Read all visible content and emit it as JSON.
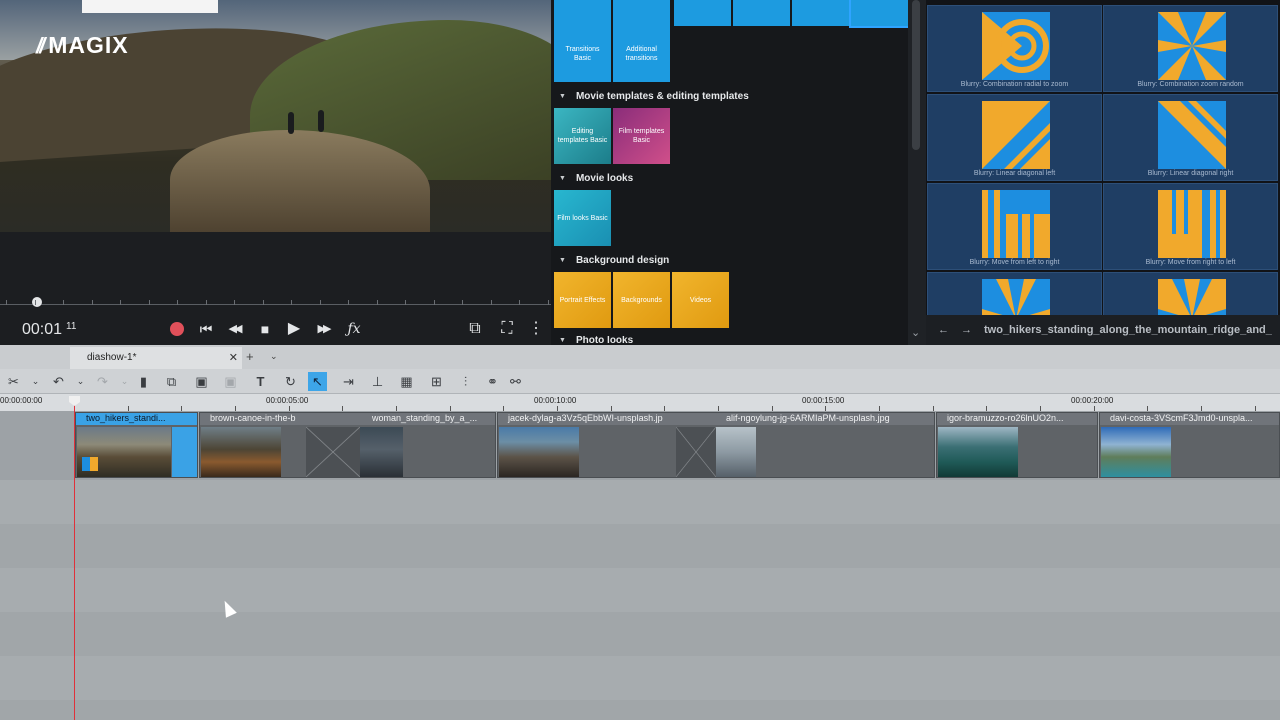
{
  "brand": {
    "logo_slashes": "//",
    "logo_text": "MAGIX"
  },
  "preview": {
    "timecode": "00:01",
    "timecode_frames": "11",
    "icons": [
      "record-icon",
      "skip-start-icon",
      "rewind-icon",
      "stop-icon",
      "play-icon",
      "fast-forward-icon",
      "fx-icon",
      "cast-icon",
      "fullscreen-icon",
      "more-vertical-icon"
    ],
    "playback_glyphs": {
      "skip_start": "⏮",
      "rewind": "◀◀",
      "stop": "■",
      "play": "▶",
      "fast_forward": "▶▶",
      "fx": "ƒx",
      "cast": "⧉",
      "fullscreen": "⛶",
      "more": "⋮"
    }
  },
  "media_pool": {
    "tiles_top": [
      {
        "label": "Transitions Basic"
      },
      {
        "label": "Additional transitions"
      }
    ],
    "sections": [
      {
        "title": "Movie templates & editing templates",
        "tiles": [
          "Editing templates Basic",
          "Film templates Basic"
        ]
      },
      {
        "title": "Movie looks",
        "tiles": [
          "Film looks Basic"
        ]
      },
      {
        "title": "Background design",
        "tiles": [
          "Portrait Effects",
          "Backgrounds",
          "Videos"
        ]
      },
      {
        "title": "Photo looks",
        "tiles": []
      }
    ],
    "scroll_down_glyph": "⌄"
  },
  "effects_panel": {
    "items": [
      {
        "caption": "Blurry: Combination radial to zoom"
      },
      {
        "caption": "Blurry: Combination zoom random"
      },
      {
        "caption": "Blurry: Linear diagonal left"
      },
      {
        "caption": "Blurry: Linear diagonal right"
      },
      {
        "caption": "Blurry: Move from left to right"
      },
      {
        "caption": "Blurry: Move from right to left"
      },
      {
        "caption": ""
      },
      {
        "caption": ""
      }
    ],
    "nav_back": "←",
    "nav_forward": "→",
    "current_file": "two_hikers_standing_along_the_mountain_ridge_and_"
  },
  "project_tab": {
    "label": "diashow-1*",
    "close": "✕",
    "add": "+",
    "menu": "⌄"
  },
  "toolbar": {
    "tools": [
      "cut-icon",
      "undo-icon",
      "redo-icon",
      "delete-icon",
      "copy-icon",
      "paste-icon",
      "paste-special-icon",
      "text-icon",
      "rotate-icon",
      "pointer-icon",
      "edit-mode-icon",
      "split-icon",
      "group-icon",
      "ungroup-icon",
      "mixer-icon",
      "link-icon",
      "unlink-icon"
    ],
    "glyphs": {
      "cut": "✂",
      "undo": "↶",
      "redo": "↷",
      "delete": "🗑",
      "copy": "⧉",
      "paste": "📋",
      "text": "T",
      "rotate": "↻",
      "pointer": "➤",
      "link": "🔗"
    }
  },
  "ruler": {
    "labels": [
      "00:00:00:00",
      "00:00:05:00",
      "00:00:10:00",
      "00:00:15:00",
      "00:00:20:00"
    ]
  },
  "timeline": {
    "clips": [
      {
        "name": "two_hikers_standi...",
        "selected": true
      },
      {
        "name": "brown-canoe-in-the-b",
        "selected": false
      },
      {
        "name": "woman_standing_by_a_...",
        "selected": false
      },
      {
        "name": "jacek-dylag-a3Vz5qEbbWI-unsplash.jp",
        "selected": false
      },
      {
        "name": "alif-ngoylung-jg-6ARMIaPM-unsplash.jpg",
        "selected": false
      },
      {
        "name": "igor-bramuzzo-ro26lnUO2n...",
        "selected": false
      },
      {
        "name": "davi-costa-3VScmF3Jmd0-unspla...",
        "selected": false
      }
    ]
  },
  "colors": {
    "accent": "#3aa2e6",
    "playhead": "#e0303a",
    "effect_yellow": "#f1a92c",
    "effect_blue": "#1d8ee0"
  }
}
